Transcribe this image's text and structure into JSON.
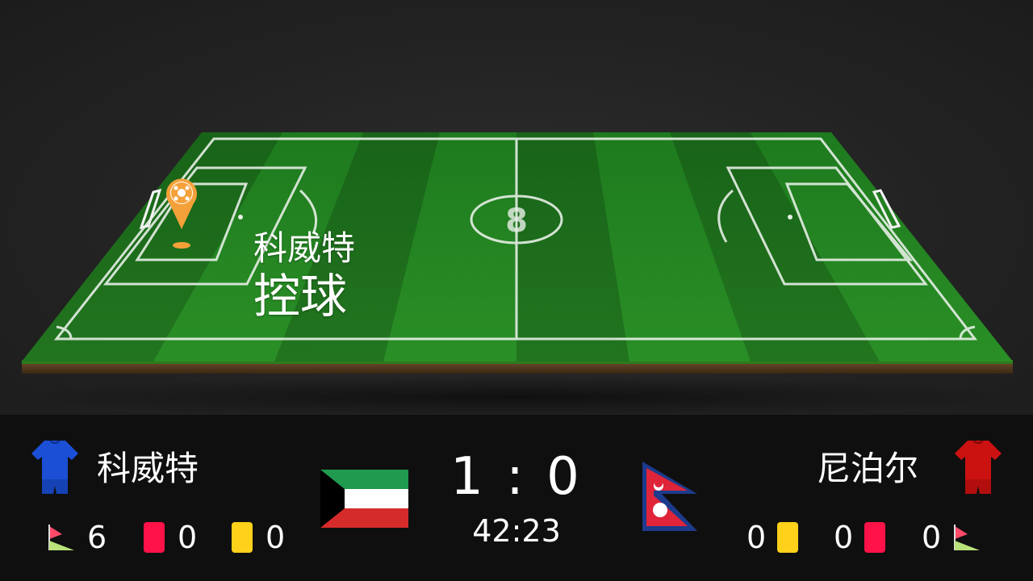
{
  "pitch": {
    "center_mark": "8",
    "possession_team": "科威特",
    "possession_action": "控球",
    "ball_marker_icon": "ball-location-pin-icon"
  },
  "home": {
    "name": "科威特",
    "jersey_color": "#1a4fd6",
    "corners": "6",
    "red_cards": "0",
    "yellow_cards": "0",
    "flag": "kuwait-flag"
  },
  "away": {
    "name": "尼泊尔",
    "jersey_color": "#cc1111",
    "yellow_cards": "0",
    "red_cards": "0",
    "corners": "0",
    "flag": "nepal-flag"
  },
  "match": {
    "score": "1 : 0",
    "clock": "42:23"
  },
  "colors": {
    "red_card": "#ff1248",
    "yellow_card": "#ffd11a",
    "marker": "#f5a13a"
  }
}
